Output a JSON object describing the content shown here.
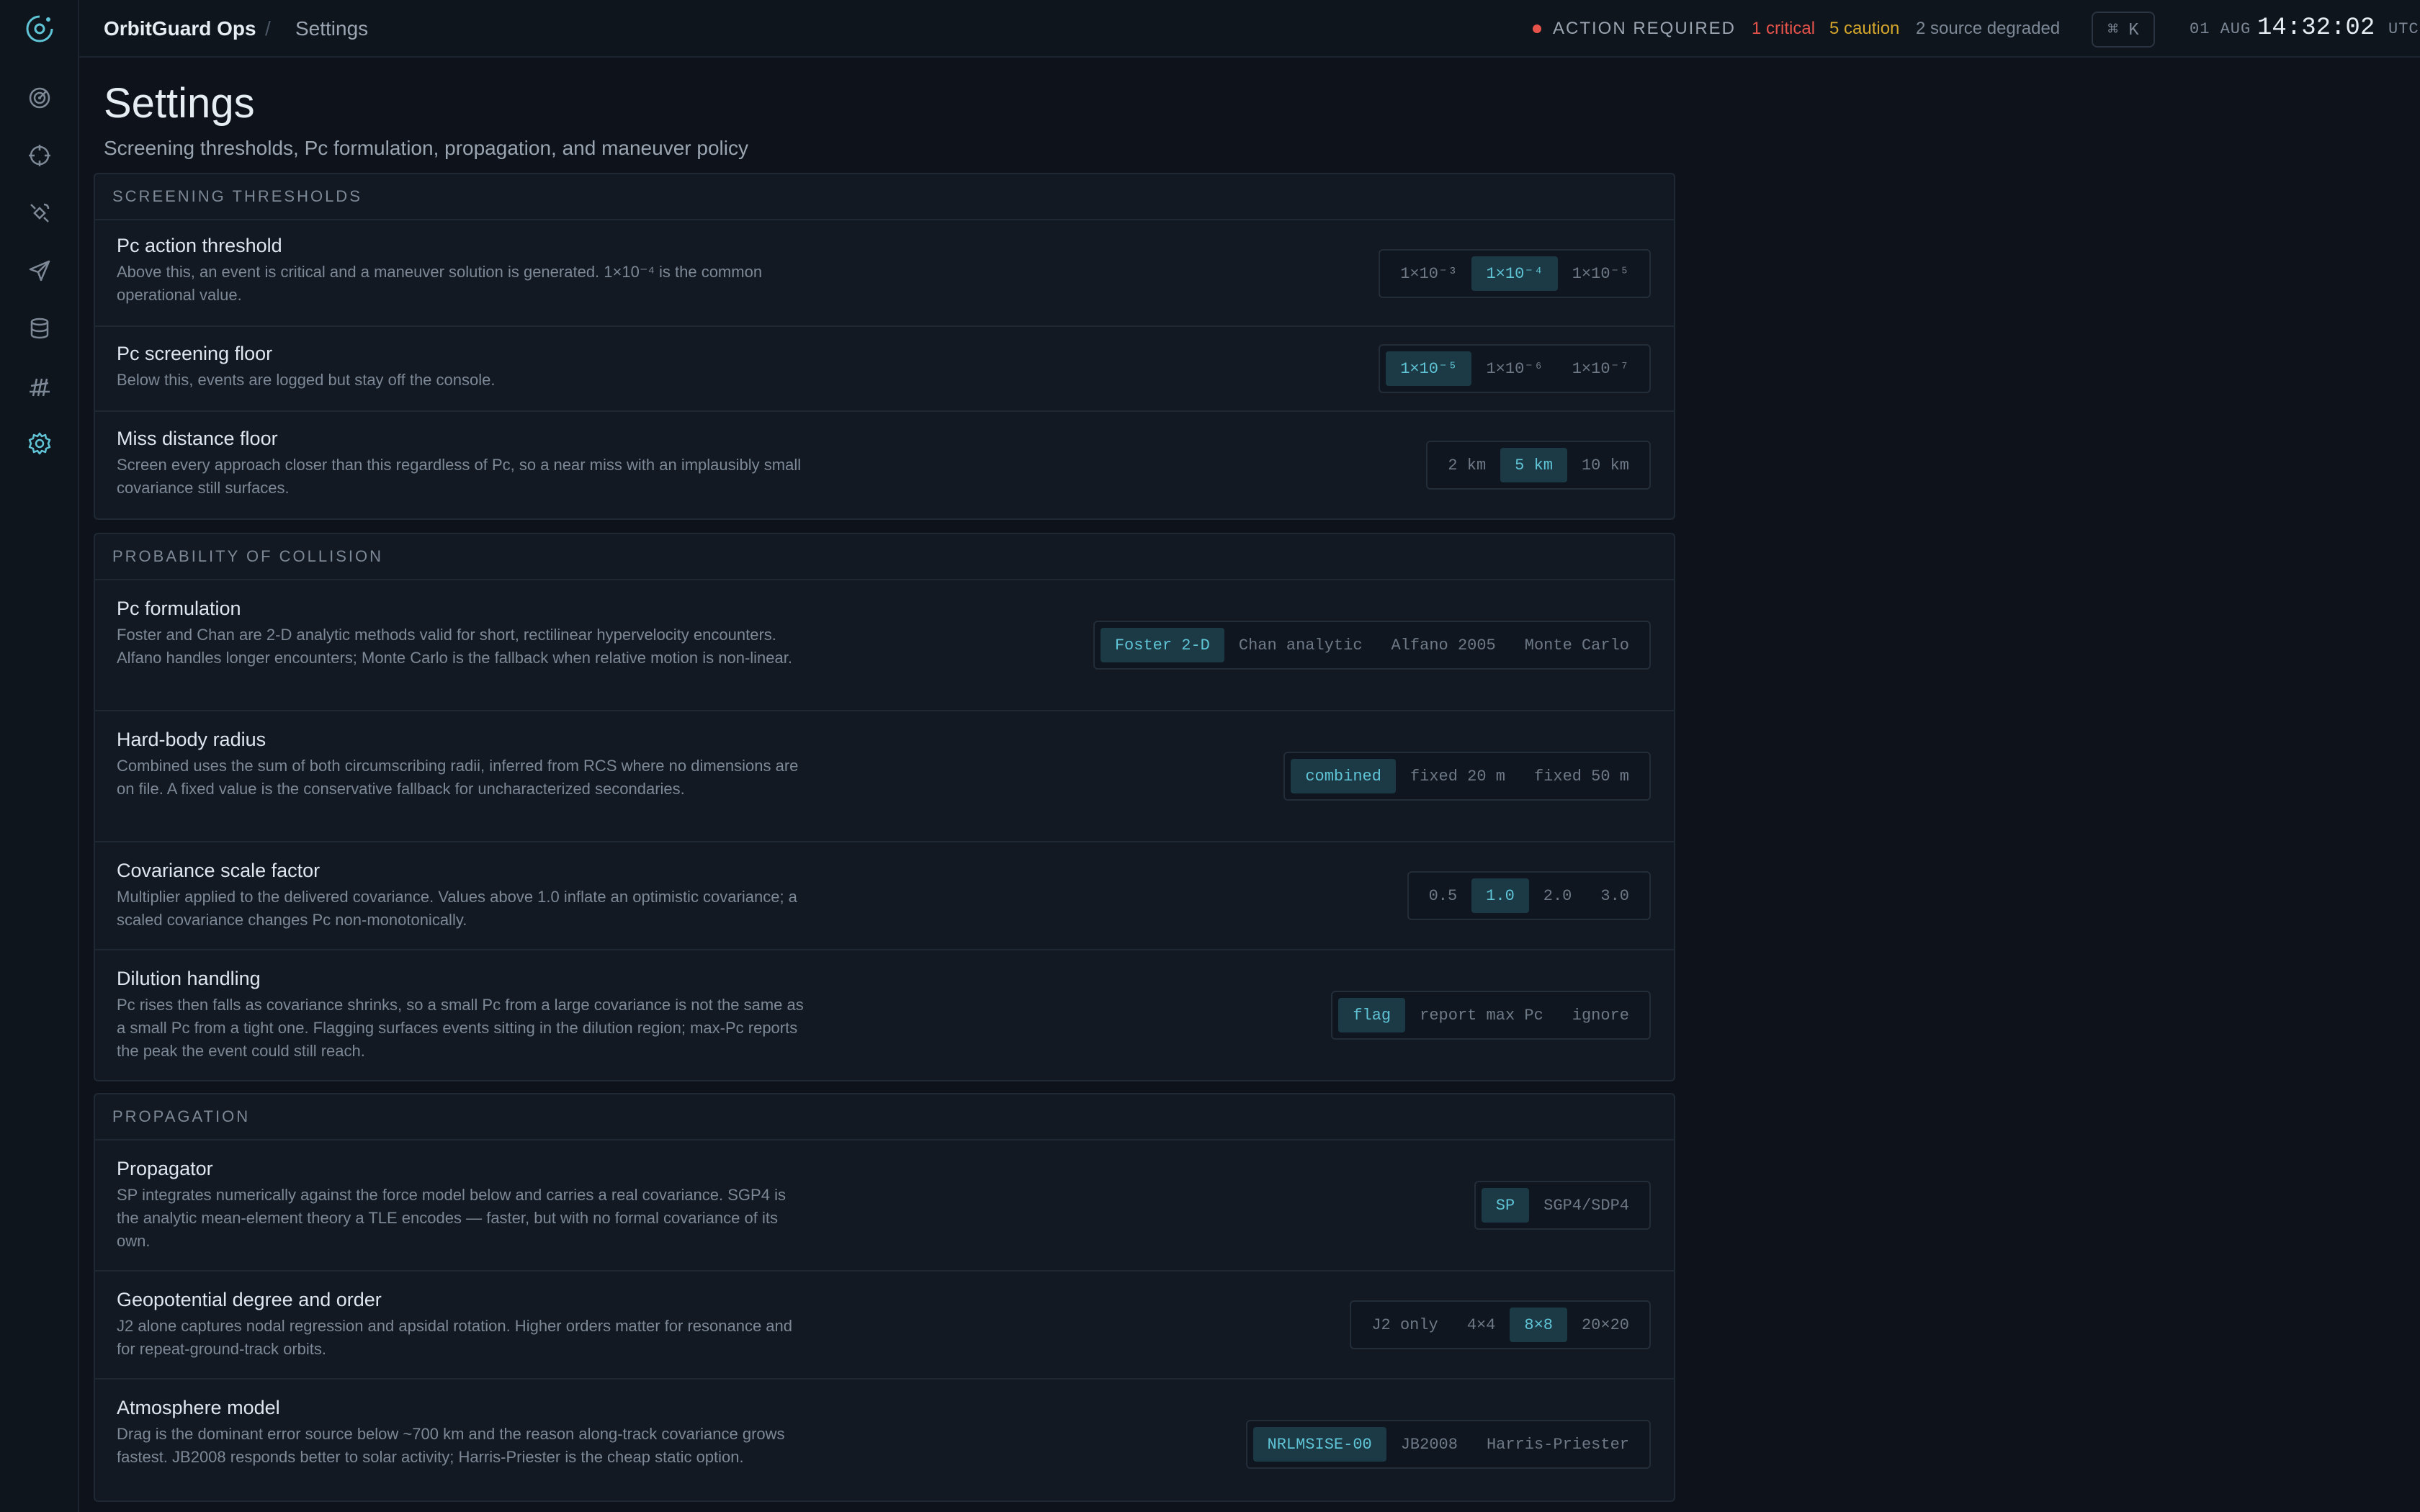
{
  "app": {
    "brand": "OrbitGuard Ops",
    "breadcrumb": "Settings",
    "separator": "/"
  },
  "status": {
    "alert_label": "ACTION REQUIRED",
    "critical": "1 critical",
    "caution": "5 caution",
    "degraded": "2 source degraded",
    "shortcut": "⌘ K",
    "date": "01 AUG",
    "time": "14:32:02",
    "tz": "UTC"
  },
  "colors": {
    "accent": "#5fc4d6",
    "critical": "#e5534b",
    "caution": "#d4a72c",
    "background": "#0e131b"
  },
  "sidebar": {
    "logo": "orbit-logo-icon",
    "items": [
      {
        "icon": "radar-icon"
      },
      {
        "icon": "crosshair-icon"
      },
      {
        "icon": "satellite-icon"
      },
      {
        "icon": "send-icon"
      },
      {
        "icon": "database-icon"
      },
      {
        "icon": "antenna-icon"
      },
      {
        "icon": "gear-icon",
        "active": true
      }
    ]
  },
  "page": {
    "title": "Settings",
    "subtitle": "Screening thresholds, Pc formulation, propagation, and maneuver policy"
  },
  "sections": [
    {
      "title": "SCREENING THRESHOLDS",
      "rows": [
        {
          "title": "Pc action threshold",
          "desc": "Above this, an event is critical and a maneuver solution is generated. 1×10⁻⁴ is the common operational value.",
          "options": [
            "1×10⁻³",
            "1×10⁻⁴",
            "1×10⁻⁵"
          ],
          "selected": 1
        },
        {
          "title": "Pc screening floor",
          "desc": "Below this, events are logged but stay off the console.",
          "options": [
            "1×10⁻⁵",
            "1×10⁻⁶",
            "1×10⁻⁷"
          ],
          "selected": 0
        },
        {
          "title": "Miss distance floor",
          "desc": "Screen every approach closer than this regardless of Pc, so a near miss with an implausibly small covariance still surfaces.",
          "options": [
            "2 km",
            "5 km",
            "10 km"
          ],
          "selected": 1
        }
      ]
    },
    {
      "title": "PROBABILITY OF COLLISION",
      "rows": [
        {
          "title": "Pc formulation",
          "desc": "Foster and Chan are 2-D analytic methods valid for short, rectilinear hypervelocity encounters. Alfano handles longer encounters; Monte Carlo is the fallback when relative motion is non-linear.",
          "options": [
            "Foster 2-D",
            "Chan analytic",
            "Alfano 2005",
            "Monte Carlo"
          ],
          "selected": 0
        },
        {
          "title": "Hard-body radius",
          "desc": "Combined uses the sum of both circumscribing radii, inferred from RCS where no dimensions are on file. A fixed value is the conservative fallback for uncharacterized secondaries.",
          "options": [
            "combined",
            "fixed 20 m",
            "fixed 50 m"
          ],
          "selected": 0
        },
        {
          "title": "Covariance scale factor",
          "desc": "Multiplier applied to the delivered covariance. Values above 1.0 inflate an optimistic covariance; a scaled covariance changes Pc non-monotonically.",
          "options": [
            "0.5",
            "1.0",
            "2.0",
            "3.0"
          ],
          "selected": 1
        },
        {
          "title": "Dilution handling",
          "desc": "Pc rises then falls as covariance shrinks, so a small Pc from a large covariance is not the same as a small Pc from a tight one. Flagging surfaces events sitting in the dilution region; max-Pc reports the peak the event could still reach.",
          "options": [
            "flag",
            "report max Pc",
            "ignore"
          ],
          "selected": 0
        }
      ]
    },
    {
      "title": "PROPAGATION",
      "rows": [
        {
          "title": "Propagator",
          "desc": "SP integrates numerically against the force model below and carries a real covariance. SGP4 is the analytic mean-element theory a TLE encodes — faster, but with no formal covariance of its own.",
          "options": [
            "SP",
            "SGP4/SDP4"
          ],
          "selected": 0
        },
        {
          "title": "Geopotential degree and order",
          "desc": "J2 alone captures nodal regression and apsidal rotation. Higher orders matter for resonance and for repeat-ground-track orbits.",
          "options": [
            "J2 only",
            "4×4",
            "8×8",
            "20×20"
          ],
          "selected": 2
        },
        {
          "title": "Atmosphere model",
          "desc": "Drag is the dominant error source below ~700 km and the reason along-track covariance grows fastest. JB2008 responds better to solar activity; Harris-Priester is the cheap static option.",
          "options": [
            "NRLMSISE-00",
            "JB2008",
            "Harris-Priester"
          ],
          "selected": 0
        }
      ]
    }
  ]
}
